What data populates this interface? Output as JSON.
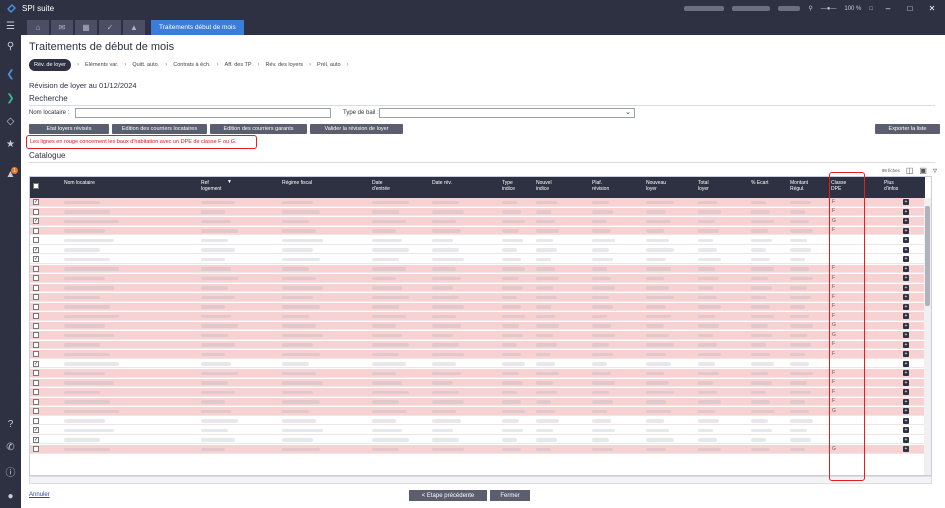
{
  "app": {
    "title": "SPI suite",
    "zoom": "100 %"
  },
  "tabs": {
    "active_label": "Traitements début de mois"
  },
  "page": {
    "title": "Traitements de début de mois",
    "subtitle": "Révision de loyer au 01/12/2024",
    "steps": [
      "Rév. de loyer",
      "Eléments var.",
      "Quitt. auto.",
      "Contrats à éch.",
      "Aff. des TP",
      "Rév. des loyers",
      "Prél. auto"
    ]
  },
  "search": {
    "title": "Recherche",
    "name_label": "Nom locataire :",
    "name_value": "",
    "type_label": "Type de bail :",
    "type_value": ""
  },
  "actions": {
    "etat": "Etat loyers révisés",
    "edition_loc": "Edition des courriers locataires",
    "edition_gar": "Edition des courriers garants",
    "valider": "Valider la révision de loyer",
    "exporter": "Exporter la liste"
  },
  "warning": "Les lignes en rouge concernent les baux d'habitation avec un DPE de classe F ou G.",
  "catalogue": {
    "title": "Catalogue",
    "count": "98 fiches",
    "columns": [
      "Nom locataire",
      "Ref logement",
      "Régime fiscal",
      "Date d'entrée",
      "Date rév.",
      "Type indice",
      "Nouvel indice",
      "Plaf. révision",
      "Nouveau loyer",
      "Total loyer",
      "% Ecart",
      "Montant Régul.",
      "Classe DPE",
      "Plus d'infos"
    ],
    "rows": [
      {
        "checked": true,
        "red": true,
        "dpe": "F"
      },
      {
        "checked": false,
        "red": true,
        "dpe": "F"
      },
      {
        "checked": true,
        "red": true,
        "dpe": "G"
      },
      {
        "checked": false,
        "red": true,
        "dpe": "F"
      },
      {
        "checked": false,
        "red": false,
        "dpe": ""
      },
      {
        "checked": true,
        "red": false,
        "dpe": ""
      },
      {
        "checked": true,
        "red": false,
        "dpe": ""
      },
      {
        "checked": false,
        "red": true,
        "dpe": "F"
      },
      {
        "checked": false,
        "red": true,
        "dpe": "F"
      },
      {
        "checked": false,
        "red": true,
        "dpe": "F"
      },
      {
        "checked": false,
        "red": true,
        "dpe": "F"
      },
      {
        "checked": false,
        "red": true,
        "dpe": "F"
      },
      {
        "checked": false,
        "red": true,
        "dpe": "F"
      },
      {
        "checked": false,
        "red": true,
        "dpe": "G"
      },
      {
        "checked": false,
        "red": true,
        "dpe": "G"
      },
      {
        "checked": false,
        "red": true,
        "dpe": "F"
      },
      {
        "checked": false,
        "red": true,
        "dpe": "F"
      },
      {
        "checked": true,
        "red": false,
        "dpe": ""
      },
      {
        "checked": false,
        "red": true,
        "dpe": "F"
      },
      {
        "checked": false,
        "red": true,
        "dpe": "F"
      },
      {
        "checked": false,
        "red": true,
        "dpe": "F"
      },
      {
        "checked": false,
        "red": true,
        "dpe": "F"
      },
      {
        "checked": false,
        "red": true,
        "dpe": "G"
      },
      {
        "checked": false,
        "red": false,
        "dpe": ""
      },
      {
        "checked": true,
        "red": false,
        "dpe": ""
      },
      {
        "checked": true,
        "red": false,
        "dpe": ""
      },
      {
        "checked": false,
        "red": true,
        "dpe": "G"
      }
    ]
  },
  "footer": {
    "cancel": "Annuler",
    "prev": "< Etape précédente",
    "close": "Fermer"
  },
  "colors": {
    "header": "#2d3142",
    "accent": "#3b7dd8",
    "red_row": "#f8d2d2",
    "highlight": "#e02020"
  }
}
